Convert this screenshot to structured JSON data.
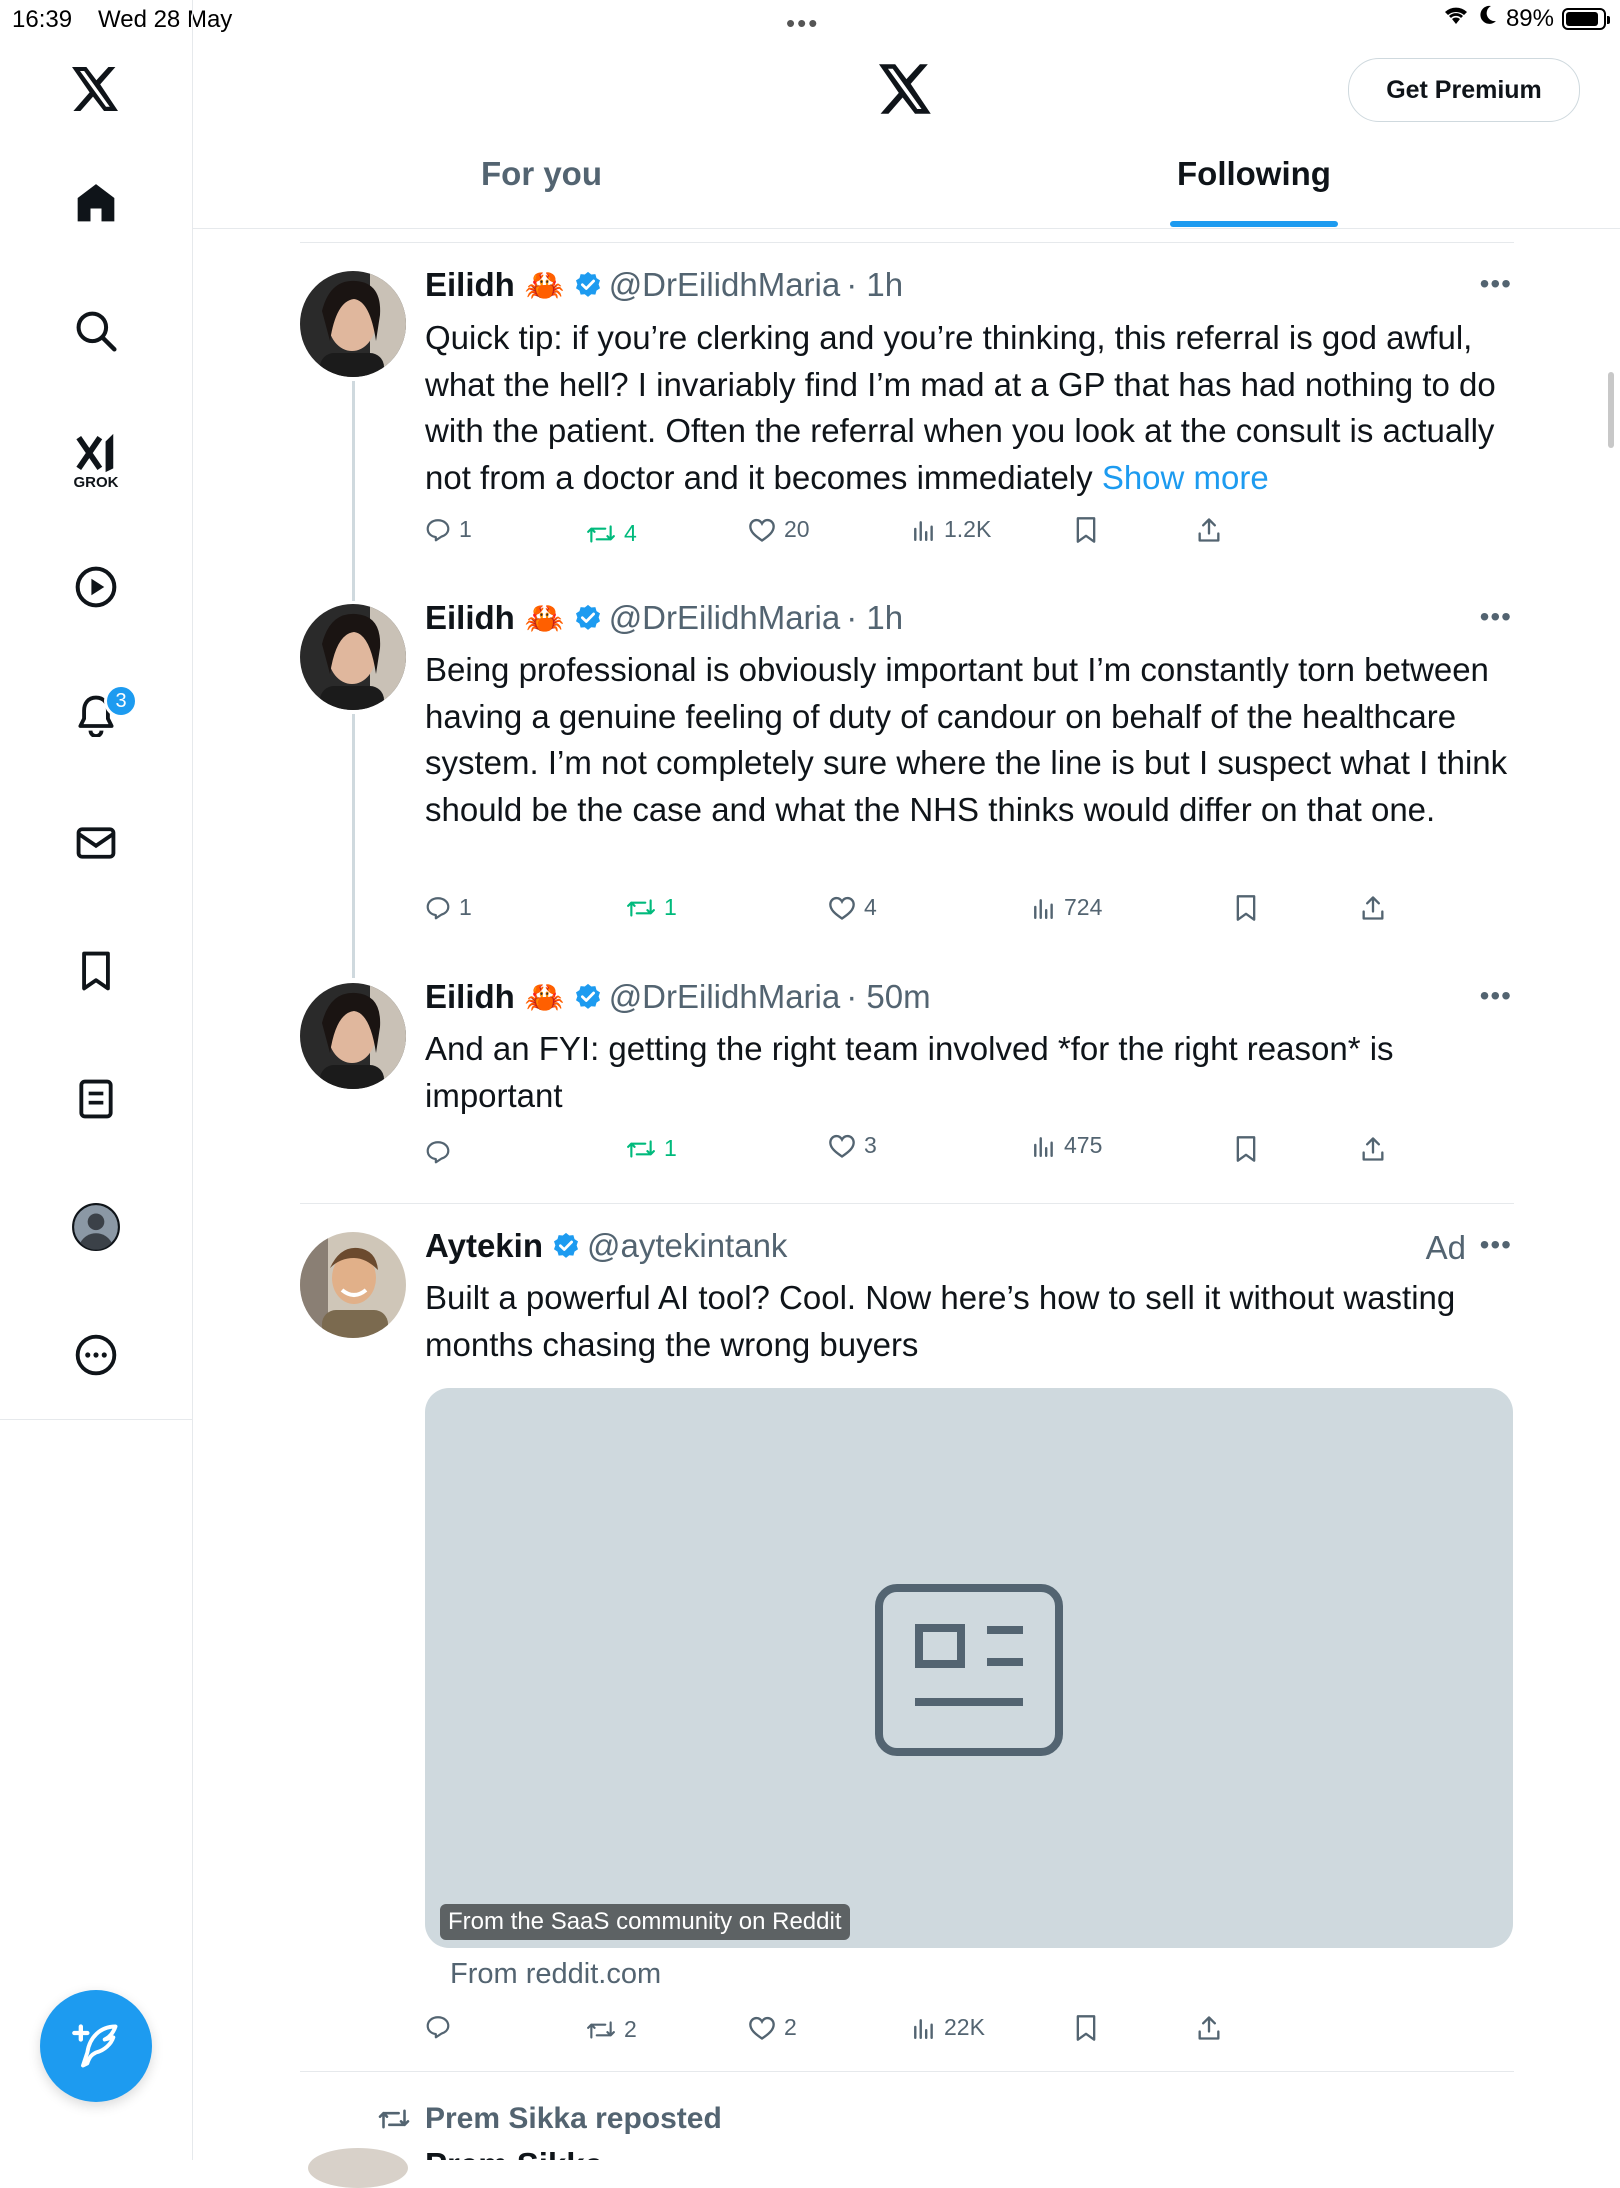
{
  "status_bar": {
    "time": "16:39",
    "date": "Wed 28 May",
    "battery": "89%",
    "battery_level": 0.89
  },
  "sidebar": {
    "items": [
      {
        "name": "x-logo",
        "icon": "x-logo-icon"
      },
      {
        "name": "home",
        "icon": "home-icon"
      },
      {
        "name": "search",
        "icon": "search-icon"
      },
      {
        "name": "grok",
        "icon": "grok-icon",
        "label": "GROK"
      },
      {
        "name": "video",
        "icon": "play-icon"
      },
      {
        "name": "notifications",
        "icon": "bell-icon",
        "badge": "3"
      },
      {
        "name": "messages",
        "icon": "envelope-icon"
      },
      {
        "name": "bookmarks",
        "icon": "bookmark-icon"
      },
      {
        "name": "lists",
        "icon": "list-icon"
      },
      {
        "name": "profile",
        "icon": "profile-icon"
      },
      {
        "name": "more",
        "icon": "more-circle-icon"
      }
    ]
  },
  "header": {
    "premium_label": "Get Premium",
    "tabs": [
      {
        "label": "For you",
        "active": false
      },
      {
        "label": "Following",
        "active": true
      }
    ]
  },
  "tweets": [
    {
      "name": "Eilidh",
      "emoji": "🦀",
      "handle": "@DrEilidhMaria",
      "time": "· 1h",
      "text": "Quick tip: if you’re clerking and you’re thinking, this referral is god awful, what the hell? I invariably find I’m mad at a GP that has had nothing to do with the patient. Often the referral when you look at the consult is actually not from a doctor and it becomes immediately",
      "show_more": "Show more",
      "replies": "1",
      "reposts": "4",
      "likes": "20",
      "views": "1.2K"
    },
    {
      "name": "Eilidh",
      "emoji": "🦀",
      "handle": "@DrEilidhMaria",
      "time": "· 1h",
      "text": "Being professional is obviously important but I’m constantly torn between having a genuine feeling of duty of candour on behalf of the healthcare system. I’m not completely sure where the line is but I suspect what I think should be the case and what the NHS thinks would differ on that one.",
      "replies": "1",
      "reposts": "1",
      "likes": "4",
      "views": "724"
    },
    {
      "name": "Eilidh",
      "emoji": "🦀",
      "handle": "@DrEilidhMaria",
      "time": "· 50m",
      "text": "And an FYI: getting the right team involved *for the right reason* is important",
      "replies": "",
      "reposts": "1",
      "likes": "3",
      "views": "475"
    },
    {
      "name": "Aytekin",
      "handle": "@aytekintank",
      "ad_label": "Ad",
      "text": "Built a powerful AI tool? Cool. Now here’s how to sell it without wasting months chasing the wrong buyers",
      "card_caption": "From the SaaS community on Reddit",
      "card_domain": "From reddit.com",
      "replies": "",
      "reposts": "2",
      "likes": "2",
      "views": "22K"
    }
  ],
  "next_tweet": {
    "reposted_by": "Prem Sikka reposted",
    "name": "Prem Sikka"
  },
  "colors": {
    "accent": "#1d9bf0",
    "text": "#0f1419",
    "secondary": "#536471",
    "repost_green": "#00ba7c",
    "border": "#e6e9ec"
  }
}
